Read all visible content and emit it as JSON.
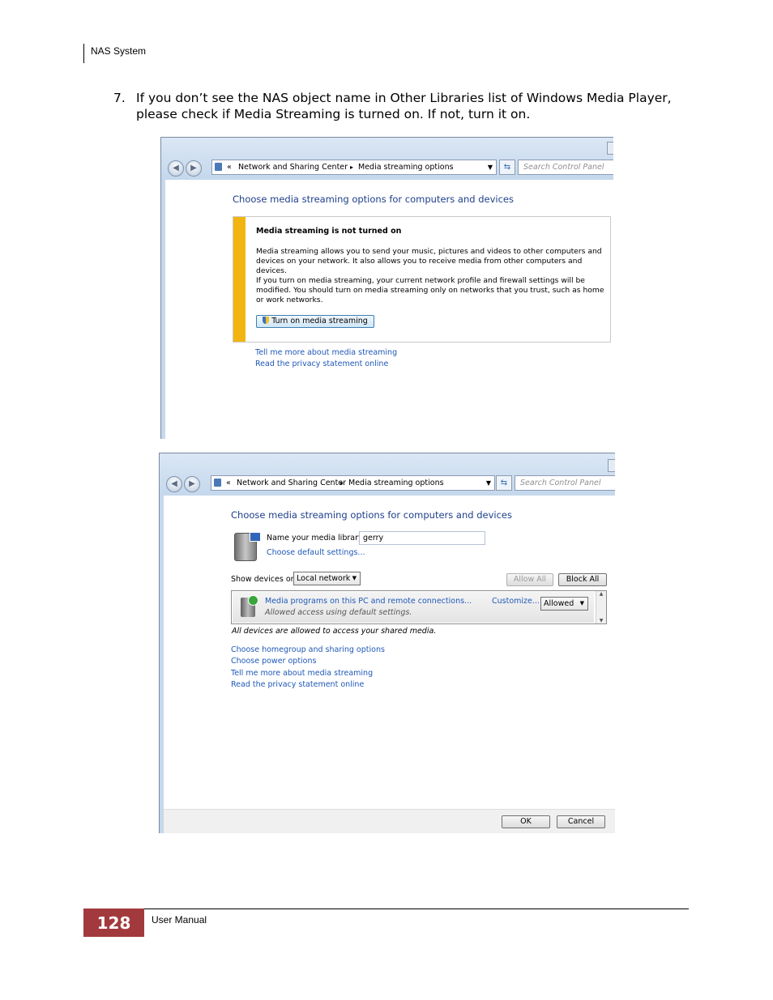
{
  "page": {
    "header": "NAS System",
    "step_number": "7.",
    "step_text": "If you don’t see the NAS object name in Other Libraries list of Windows Media Player, please check if Media Streaming is turned on. If not, turn it on.",
    "page_number": "128",
    "footer": "User Manual"
  },
  "window1": {
    "breadcrumb_sep": "«",
    "crumb1": "Network and Sharing Center",
    "crumb_arrow": "▸",
    "crumb2": "Media streaming options",
    "search_placeholder": "Search Control Panel",
    "heading": "Choose media streaming options for computers and devices",
    "notice_title": "Media streaming is not turned on",
    "notice_p1": "Media streaming allows you to send your music, pictures and videos to other computers and devices on your network. It also allows you to receive media from other computers and devices.",
    "notice_p2": "If you turn on media streaming, your current network profile and firewall settings will be modified. You should turn on media streaming only on networks that you trust, such as home or work networks.",
    "turn_on_button": "Turn on media streaming",
    "link1": "Tell me more about media streaming",
    "link2": "Read the privacy statement online"
  },
  "window2": {
    "breadcrumb_sep": "«",
    "crumb1": "Network and Sharing Center",
    "crumb_arrow": "▸",
    "crumb2": "Media streaming options",
    "search_placeholder": "Search Control Panel",
    "heading": "Choose media streaming options for computers and devices",
    "library_label": "Name your media library:",
    "library_value": "gerry",
    "default_settings_link": "Choose default settings...",
    "show_devices_label": "Show devices on:",
    "show_devices_value": "Local network",
    "allow_all": "Allow All",
    "block_all": "Block All",
    "device_name": "Media programs on this PC and remote connections...",
    "device_status": "Allowed access using default settings.",
    "customize_link": "Customize...",
    "device_permission": "Allowed",
    "all_devices_note": "All devices are allowed to access your shared media.",
    "links": [
      "Choose homegroup and sharing options",
      "Choose power options",
      "Tell me more about media streaming",
      "Read the privacy statement online"
    ],
    "ok": "OK",
    "cancel": "Cancel"
  },
  "colors": {
    "footer_box": "#a23a3d",
    "warning_bar": "#f2b50f",
    "link": "#1f58b8",
    "heading": "#1e3f8a"
  },
  "icons": [
    "network-icon",
    "refresh-icon",
    "back-icon",
    "forward-icon",
    "shield-icon",
    "media-device-icon",
    "play-icon"
  ]
}
